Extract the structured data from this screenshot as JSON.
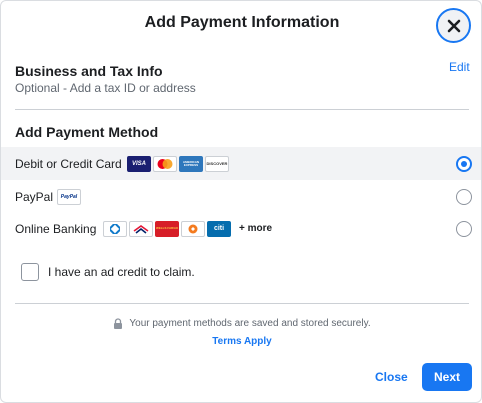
{
  "dialog": {
    "title": "Add Payment Information"
  },
  "business": {
    "heading": "Business and Tax Info",
    "subtext": "Optional - Add a tax ID or address",
    "edit_label": "Edit"
  },
  "payment": {
    "heading": "Add Payment Method",
    "options": [
      {
        "label": "Debit or Credit Card",
        "selected": true,
        "logos": [
          "visa-logo",
          "mastercard-logo",
          "amex-logo",
          "discover-logo"
        ]
      },
      {
        "label": "PayPal",
        "selected": false,
        "logos": [
          "paypal-logo"
        ]
      },
      {
        "label": "Online Banking",
        "selected": false,
        "logos": [
          "chase-logo",
          "bank-of-america-logo",
          "wells-fargo-logo",
          "us-bank-logo",
          "citi-logo"
        ],
        "more": "+ more"
      }
    ],
    "logo_text": {
      "visa": "VISA",
      "amex": "AMERICAN EXPRESS",
      "discover": "DISCOVER",
      "paypal": "PayPal",
      "wells": "WELLS FARGO",
      "citi": "citi"
    }
  },
  "ad_credit": {
    "label": "I have an ad credit to claim.",
    "checked": false
  },
  "footer": {
    "secure_text": "Your payment methods are saved and stored securely.",
    "terms_label": "Terms Apply",
    "close_label": "Close",
    "next_label": "Next"
  },
  "colors": {
    "accent": "#1877f2",
    "text": "#1c1e21",
    "muted": "#606770",
    "selected_row": "#f2f3f5"
  }
}
